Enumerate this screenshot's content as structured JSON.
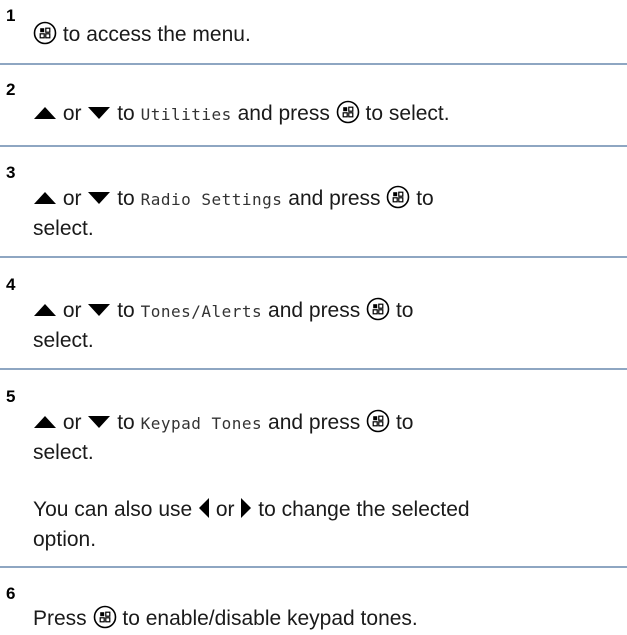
{
  "steps": [
    {
      "num": "1",
      "t1": "to access the menu."
    },
    {
      "num": "2",
      "or": "or",
      "to": "to",
      "menu": "Utilities",
      "press": "and press",
      "end": "to select."
    },
    {
      "num": "3",
      "or": "or",
      "to": "to",
      "menu": "Radio Settings",
      "press": "and press",
      "end": "to",
      "end2": "select."
    },
    {
      "num": "4",
      "or": "or",
      "to": "to",
      "menu": "Tones/Alerts",
      "press": "and press",
      "end": "to",
      "end2": "select."
    },
    {
      "num": "5",
      "or": "or",
      "to": "to",
      "menu": "Keypad Tones",
      "press": "and press",
      "end": "to",
      "end2": "select.",
      "note_a": "You can also use",
      "note_or": "or",
      "note_b": "to change the selected",
      "note_c": "option."
    },
    {
      "num": "6",
      "press": "Press",
      "end": "to enable/disable keypad tones."
    }
  ],
  "icons": [
    "menu-ok-button-icon",
    "up-arrow-icon",
    "down-arrow-icon",
    "left-arrow-icon",
    "right-arrow-icon"
  ]
}
